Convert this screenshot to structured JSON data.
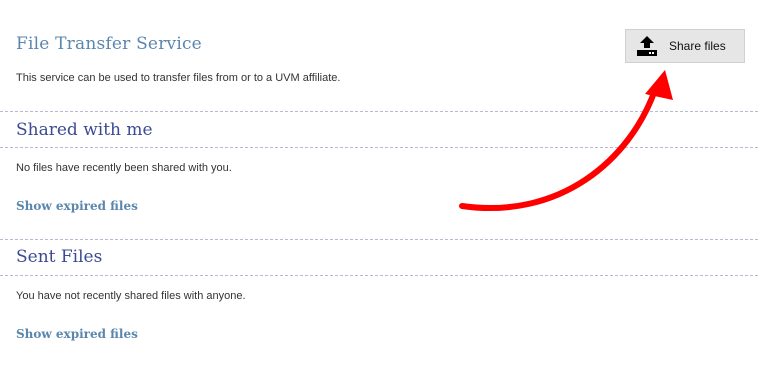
{
  "header": {
    "title": "File Transfer Service",
    "description": "This service can be used to transfer files from or to a UVM affiliate.",
    "share_button_label": "Share files",
    "share_icon": "upload-tray-icon"
  },
  "shared_with_me": {
    "title": "Shared with me",
    "empty_text": "No files have recently been shared with you.",
    "expired_link": "Show expired files"
  },
  "sent_files": {
    "title": "Sent Files",
    "empty_text": "You have not recently shared files with anyone.",
    "expired_link": "Show expired files"
  },
  "annotation": {
    "arrow_color": "#ff0000",
    "arrow_icon": "red-curved-arrow-icon"
  },
  "colors": {
    "service_title": "#5b86ad",
    "section_title": "#3b4a92",
    "link": "#5b86ad",
    "button_bg": "#e6e6e6",
    "divider": "#b9b9d3"
  }
}
